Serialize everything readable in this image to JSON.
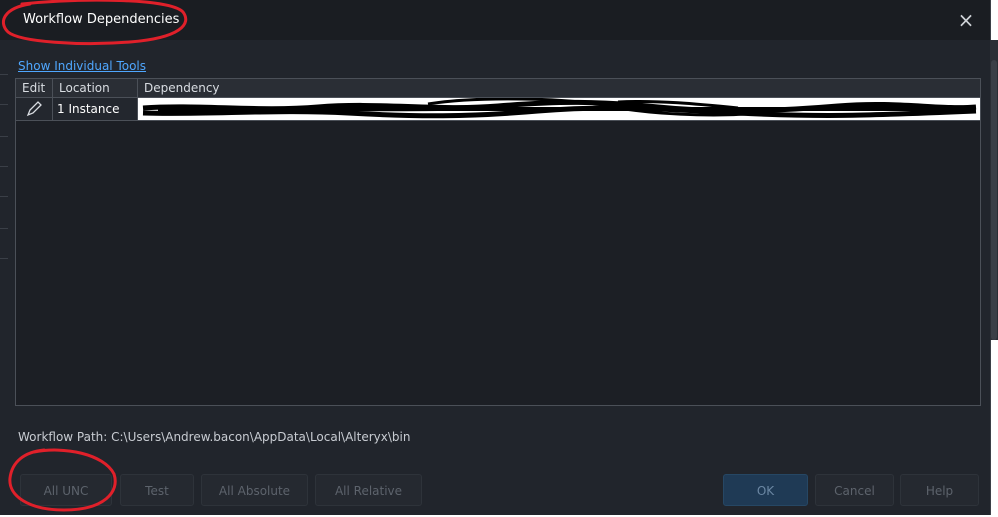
{
  "dialog": {
    "title": "Workflow Dependencies",
    "close_label": "×"
  },
  "link": {
    "show_individual_tools": "Show Individual Tools"
  },
  "grid": {
    "columns": [
      "Edit",
      "Location",
      "Dependency"
    ],
    "rows": [
      {
        "location": "1 Instance",
        "dependency": "[redacted path]"
      }
    ]
  },
  "workflow_path": {
    "label": "Workflow Path: C:\\Users\\Andrew.bacon\\AppData\\Local\\Alteryx\\bin"
  },
  "buttons": {
    "all_unc": "All UNC",
    "test": "Test",
    "all_absolute": "All Absolute",
    "all_relative": "All Relative",
    "ok": "OK",
    "cancel": "Cancel",
    "help": "Help"
  },
  "colors": {
    "annotation_red": "#e0202a",
    "link_blue": "#4fa7ff",
    "background": "#21252c"
  }
}
